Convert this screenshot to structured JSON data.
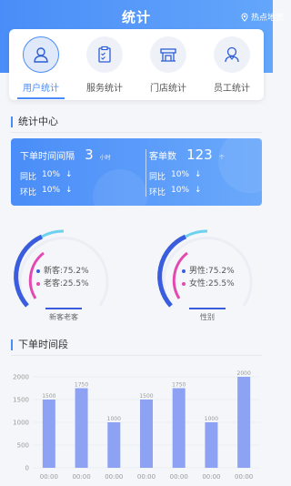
{
  "header": {
    "title": "统计",
    "hotmap_label": "热点地图"
  },
  "tabs": [
    {
      "label": "用户统计",
      "active": true,
      "icon": "user-icon"
    },
    {
      "label": "服务统计",
      "active": false,
      "icon": "clipboard-icon"
    },
    {
      "label": "门店统计",
      "active": false,
      "icon": "store-icon"
    },
    {
      "label": "员工统计",
      "active": false,
      "icon": "staff-icon"
    }
  ],
  "center": {
    "title": "统计中心",
    "order_interval": {
      "label": "下单时间间隔",
      "value": "3",
      "unit": "小时"
    },
    "customer_count": {
      "label": "客单数",
      "value": "123",
      "unit": "个"
    },
    "yoy_label": "同比",
    "yoy_value": "10%",
    "mom_label": "环比",
    "mom_value": "10%"
  },
  "gauges": [
    {
      "label": "新客老客",
      "items": [
        {
          "text": "新客:75.2%",
          "color": "#3a5ddd"
        },
        {
          "text": "老客:25.5%",
          "color": "#e24ab2"
        }
      ]
    },
    {
      "label": "性别",
      "items": [
        {
          "text": "男性:75.2%",
          "color": "#3a5ddd"
        },
        {
          "text": "女性:25.5%",
          "color": "#e24ab2"
        }
      ]
    }
  ],
  "time_section": {
    "title": "下单时间段"
  },
  "chart_data": {
    "type": "bar",
    "categories": [
      "00:00",
      "00:00",
      "00:00",
      "00:00",
      "00:00",
      "00:00",
      "00:00"
    ],
    "values": [
      1500,
      1750,
      1000,
      1500,
      1750,
      1000,
      2000
    ],
    "ylim": [
      0,
      2000
    ],
    "yticks": [
      0,
      500,
      1000,
      1500,
      2000
    ],
    "colors": {
      "bar": "#8ea2f4",
      "grid": "#e6e9ef",
      "tick": "#999999"
    }
  }
}
